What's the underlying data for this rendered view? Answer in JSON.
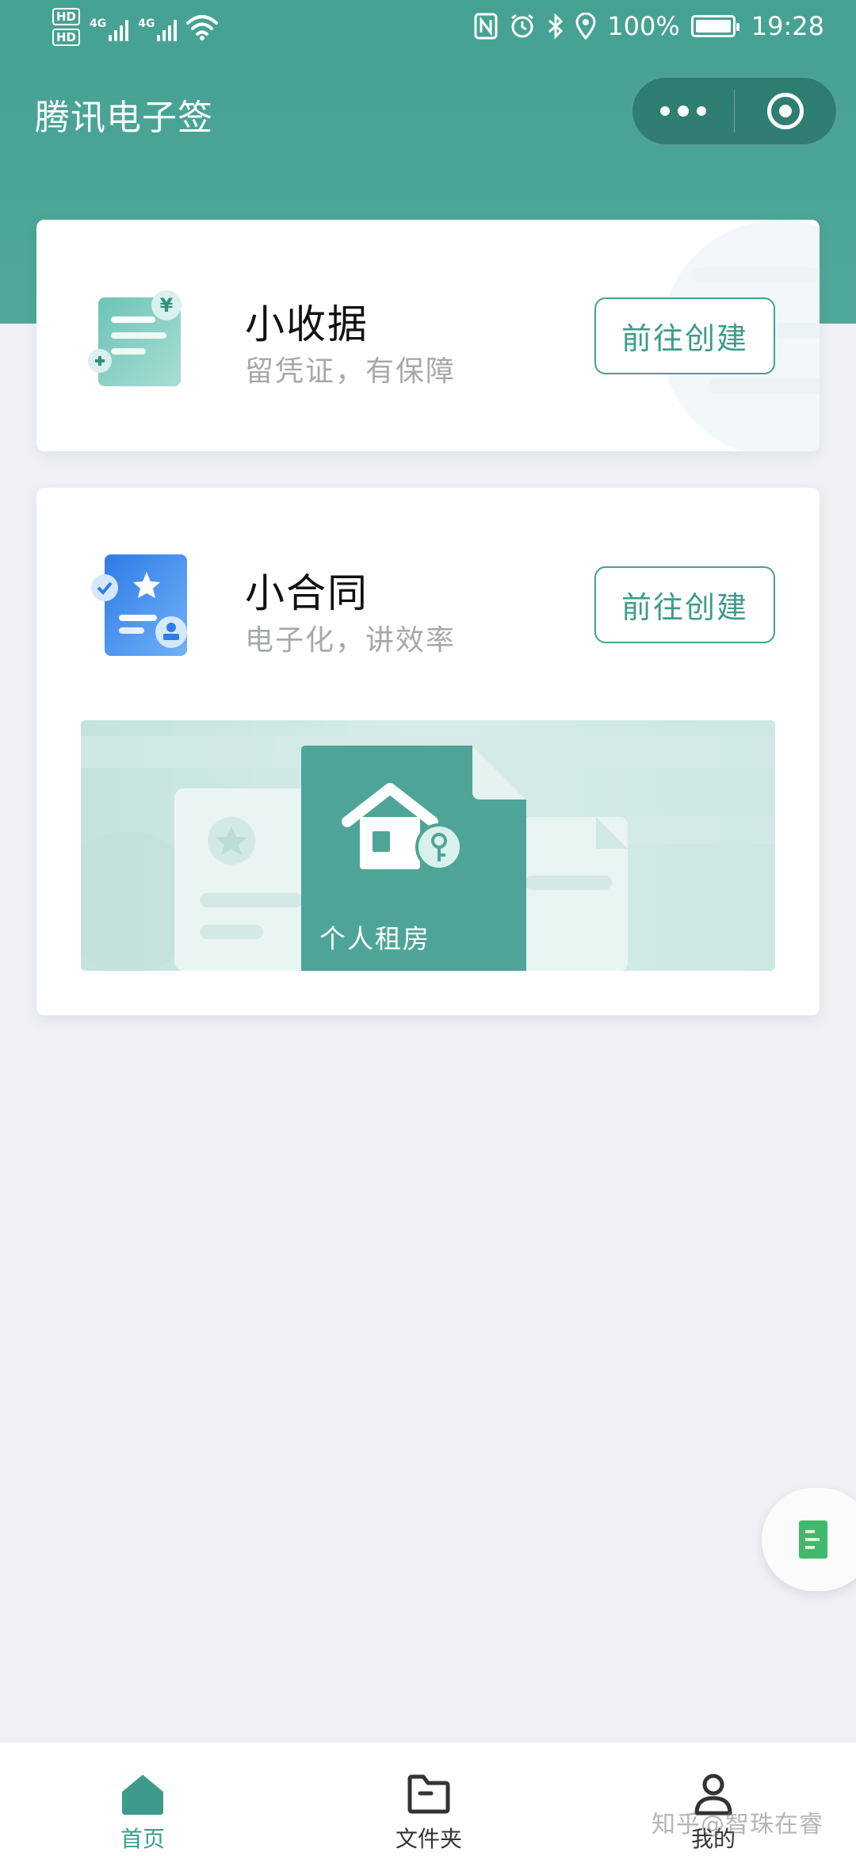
{
  "status_bar": {
    "hd1": "HD",
    "hd2": "HD",
    "net1": "4G",
    "net2": "4G",
    "battery": "100%",
    "time": "19:28"
  },
  "nav": {
    "title": "腾讯电子签"
  },
  "cards": [
    {
      "title": "小收据",
      "subtitle": "留凭证，有保障",
      "button": "前往创建",
      "icon": "receipt-icon"
    },
    {
      "title": "小合同",
      "subtitle": "电子化，讲效率",
      "button": "前往创建",
      "icon": "contract-icon",
      "banner_label": "个人租房"
    }
  ],
  "tabbar": {
    "items": [
      {
        "label": "首页",
        "icon": "home-icon",
        "active": true
      },
      {
        "label": "文件夹",
        "icon": "folder-icon",
        "active": false
      },
      {
        "label": "我的",
        "icon": "profile-icon",
        "active": false
      }
    ]
  },
  "watermark": "知乎@智珠在睿",
  "colors": {
    "brand": "#45a192",
    "background": "#eff1f5",
    "subtitle": "#a5a8ad"
  }
}
